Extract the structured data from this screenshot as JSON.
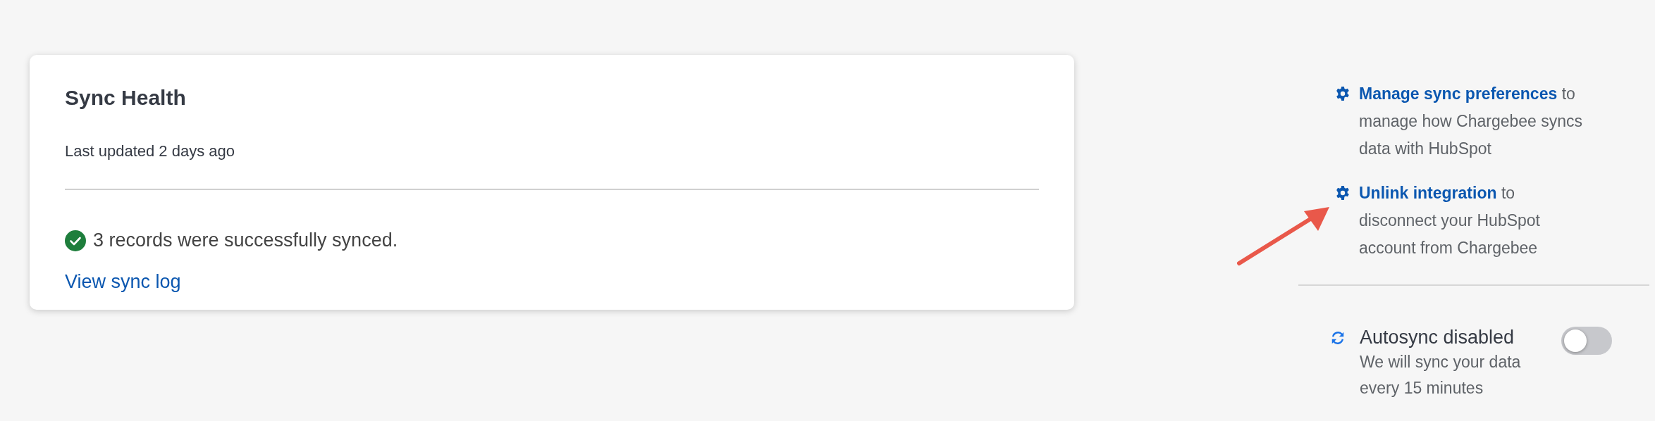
{
  "sync_health": {
    "title": "Sync Health",
    "last_updated": "Last updated 2 days ago",
    "status": {
      "kind": "success",
      "text": "3 records were successfully synced."
    },
    "link": "View sync log"
  },
  "actions": [
    {
      "link": "Manage sync preferences",
      "rest": "to manage how Chargebee syncs data with HubSpot"
    },
    {
      "link": "Unlink integration",
      "rest": "to disconnect your HubSpot account from Chargebee"
    }
  ],
  "autosync": {
    "title": "Autosync disabled",
    "description": "We will sync your data every 15 minutes",
    "on": false
  }
}
